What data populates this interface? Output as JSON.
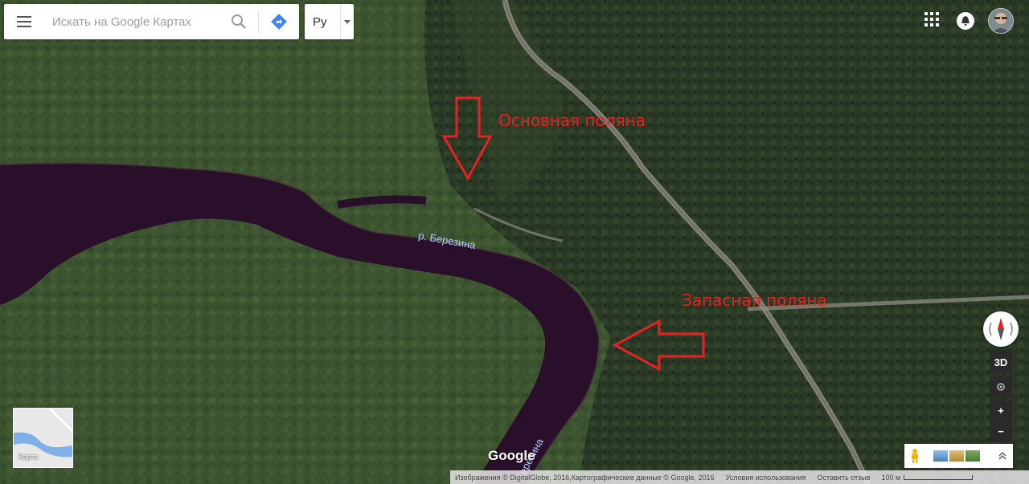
{
  "search": {
    "placeholder": "Искать на Google Картах"
  },
  "language": {
    "label": "Ру"
  },
  "annotations": {
    "main_clearing": "Основная поляна",
    "backup_clearing": "Запасная поляна",
    "river": "р. Березина",
    "river_lower": "Березина"
  },
  "controls": {
    "threeD": "3D",
    "zoom_in": "+",
    "zoom_out": "−"
  },
  "minimap": {
    "label": "Карта"
  },
  "brand": {
    "logo": "Google"
  },
  "footer": {
    "imagery": "Изображения © DigitalGlobe, 2016,Картографические данные © Google, 2016",
    "terms": "Условия использования",
    "feedback": "Оставить отзыв",
    "scale": "100 м"
  },
  "colors": {
    "annotation": "#e52222",
    "river": "#2a0f2a"
  }
}
